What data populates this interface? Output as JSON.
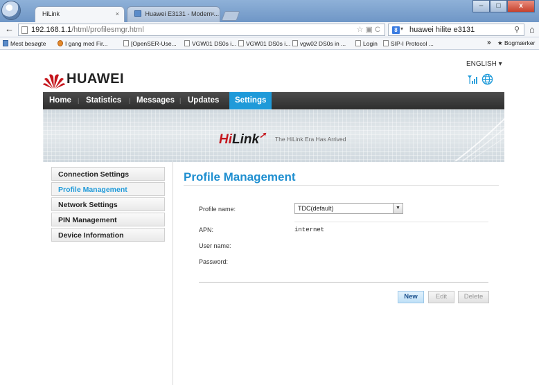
{
  "browser": {
    "tabs": [
      {
        "label": "HiLink",
        "close": "×",
        "active": true
      },
      {
        "label": "Huawei E3131 - Modem ...",
        "close": "×",
        "active": false
      }
    ],
    "window_controls": {
      "minimize": "–",
      "maximize": "□",
      "close": "x"
    },
    "url_host": "192.168.1.1",
    "url_path": "/html/profilesmgr.html",
    "search_text": "huawei hilite e3131",
    "search_engine_glyph": "8",
    "bookmarks": [
      "Mest besøgte",
      "I gang med Fir...",
      "[OpenSER-Use...",
      "VGW01 DS0s i...",
      "VGW01 DS0s i...",
      "vgw02 DS0s in ...",
      "Login",
      "SIP-I Protocol ..."
    ],
    "bookmarks_more": "»",
    "bookmarks_menu": "Bogmærker"
  },
  "header": {
    "brand": "HUAWEI",
    "language": "ENGLISH ▾"
  },
  "nav": {
    "items": [
      "Home",
      "Statistics",
      "Messages",
      "Updates",
      "Settings"
    ],
    "active": "Settings"
  },
  "banner": {
    "brand_hi": "Hi",
    "brand_link": "Link",
    "tagline": "The HiLink Era Has Arrived"
  },
  "sidebar": {
    "items": [
      {
        "label": "Connection Settings",
        "active": false
      },
      {
        "label": "Profile Management",
        "active": true
      },
      {
        "label": "Network Settings",
        "active": false
      },
      {
        "label": "PIN Management",
        "active": false
      },
      {
        "label": "Device Information",
        "active": false
      }
    ]
  },
  "main": {
    "title": "Profile Management",
    "profile_label": "Profile name:",
    "profile_value": "TDC(default)",
    "apn_label": "APN:",
    "apn_value": "internet",
    "username_label": "User name:",
    "username_value": "",
    "password_label": "Password:",
    "password_value": "",
    "buttons": {
      "new": "New",
      "edit": "Edit",
      "delete": "Delete"
    }
  },
  "colors": {
    "accent": "#1f9ad9",
    "title": "#1f8fd0",
    "nav_bg": "#3a3a3a",
    "brand_red": "#c5161d"
  }
}
